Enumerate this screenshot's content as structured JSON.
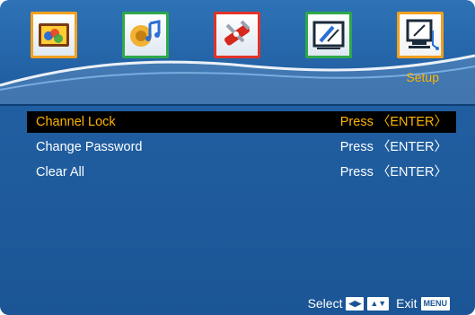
{
  "tabs": [
    {
      "name": "picture",
      "icon": "picture-icon",
      "color": "#f0a020"
    },
    {
      "name": "sound",
      "icon": "sound-icon",
      "color": "#2ea84a"
    },
    {
      "name": "function",
      "icon": "tools-icon",
      "color": "#e0342a"
    },
    {
      "name": "tv",
      "icon": "tv-icon",
      "color": "#2ea84a"
    },
    {
      "name": "setup",
      "icon": "setup-icon",
      "color": "#f0a020"
    }
  ],
  "header": {
    "selected_label": "Setup"
  },
  "menu": {
    "items": [
      {
        "label": "Channel Lock",
        "action": "Press 〈ENTER〉"
      },
      {
        "label": "Change Password",
        "action": "Press 〈ENTER〉"
      },
      {
        "label": "Clear All",
        "action": "Press 〈ENTER〉"
      }
    ]
  },
  "footer": {
    "select_label": "Select",
    "exit_label": "Exit",
    "menu_key": "MENU"
  }
}
